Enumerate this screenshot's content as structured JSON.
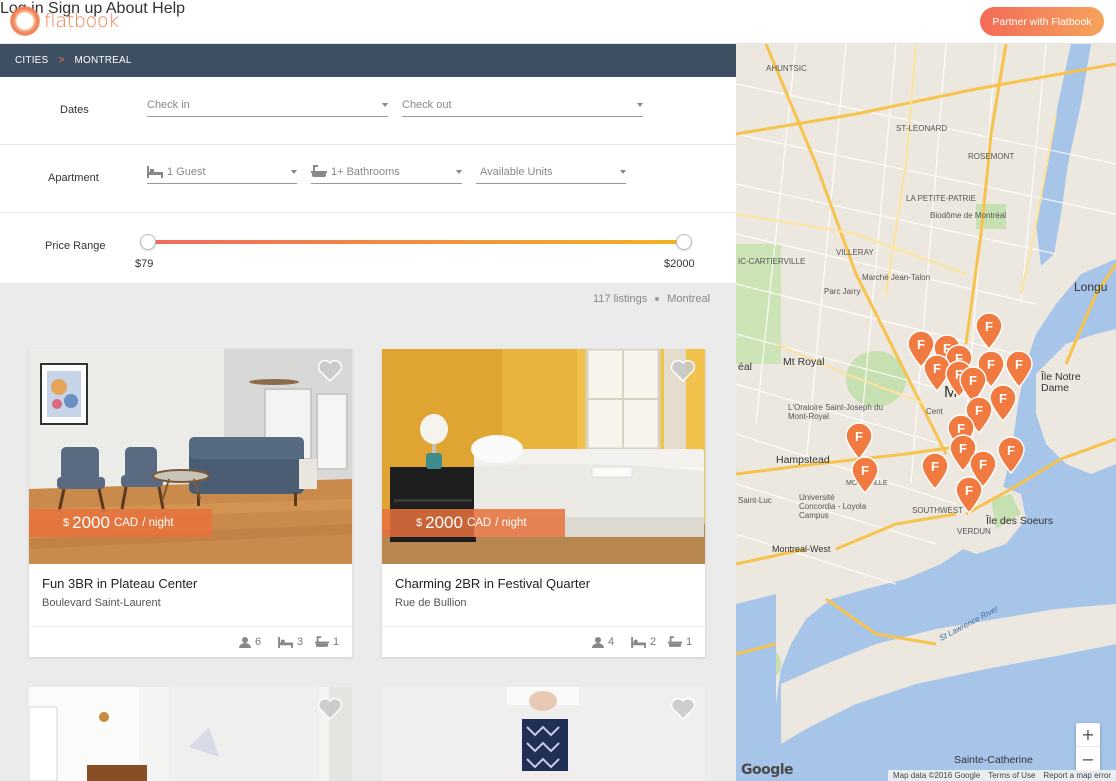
{
  "header": {
    "logo_text": "flatbook",
    "nav": [
      "Log in",
      "Sign up",
      "About",
      "Help"
    ],
    "partner_label": "Partner with Flatbook"
  },
  "breadcrumb": {
    "root": "CITIES",
    "separator": ">",
    "current": "MONTREAL"
  },
  "filters": {
    "dates_label": "Dates",
    "check_in_placeholder": "Check in",
    "check_out_placeholder": "Check out",
    "apartment_label": "Apartment",
    "guests_value": "1 Guest",
    "bathrooms_value": "1+ Bathrooms",
    "units_value": "Available Units",
    "price_label": "Price Range",
    "price_min": "$79",
    "price_max": "$2000"
  },
  "results": {
    "count": "117 listings",
    "city": "Montreal"
  },
  "listings": [
    {
      "currency_symbol": "$",
      "price": "2000",
      "currency": "CAD",
      "unit": "/ night",
      "title": "Fun 3BR in Plateau Center",
      "street": "Boulevard Saint-Laurent",
      "guests": "6",
      "beds": "3",
      "baths": "1"
    },
    {
      "currency_symbol": "$",
      "price": "2000",
      "currency": "CAD",
      "unit": "/ night",
      "title": "Charming 2BR in Festival Quarter",
      "street": "Rue de Bullion",
      "guests": "4",
      "beds": "2",
      "baths": "1"
    }
  ],
  "map": {
    "labels": {
      "cartierville": "IC-CARTIERVILLE",
      "parc_jarry": "Parc Jarry",
      "marche": "Marché Jean-Talon",
      "biodome": "Biodôme de Montréal",
      "villeray": "VILLERAY",
      "mt_royal": "Mt Royal",
      "oratoire": "L'Oratoire Saint-Joseph du Mont-Royal",
      "hampstead": "Hampstead",
      "saint_luc": "Saint-Luc",
      "concordia": "Université Concordia - Loyola Campus",
      "montreal_west": "Montreal-West",
      "verdun": "VERDUN",
      "ile_soeurs": "Île des Soeurs",
      "ile_notre_dame": "Île Notre Dame",
      "longueuil": "Longu",
      "sainte_catherine": "Sainte-Catherine",
      "st_lawrence_river": "St Lawrence River",
      "city_initial": "M",
      "city_fragment": "Cent",
      "montreal_partial": "MONT VILLE",
      "eal": "éal",
      "rosemont": "ROSEMONT",
      "petite_patrie": "LA PETITE-PATRIE",
      "saint_leonard": "ST-LEONARD",
      "ahuntsic": "AHUNTSIC",
      "southwest": "SOUTHWEST",
      "saint_henri": "ST-HENRI"
    },
    "zoom_in": "+",
    "zoom_out": "−",
    "google": "Google",
    "attribution": [
      "Map data ©2016 Google",
      "Terms of Use",
      "Report a map error"
    ],
    "pin_letter": "F",
    "colors": {
      "pin": "#f07a3f",
      "water": "#a7c5e9",
      "highway": "#f7c34d",
      "park": "#c6e0b1"
    }
  }
}
